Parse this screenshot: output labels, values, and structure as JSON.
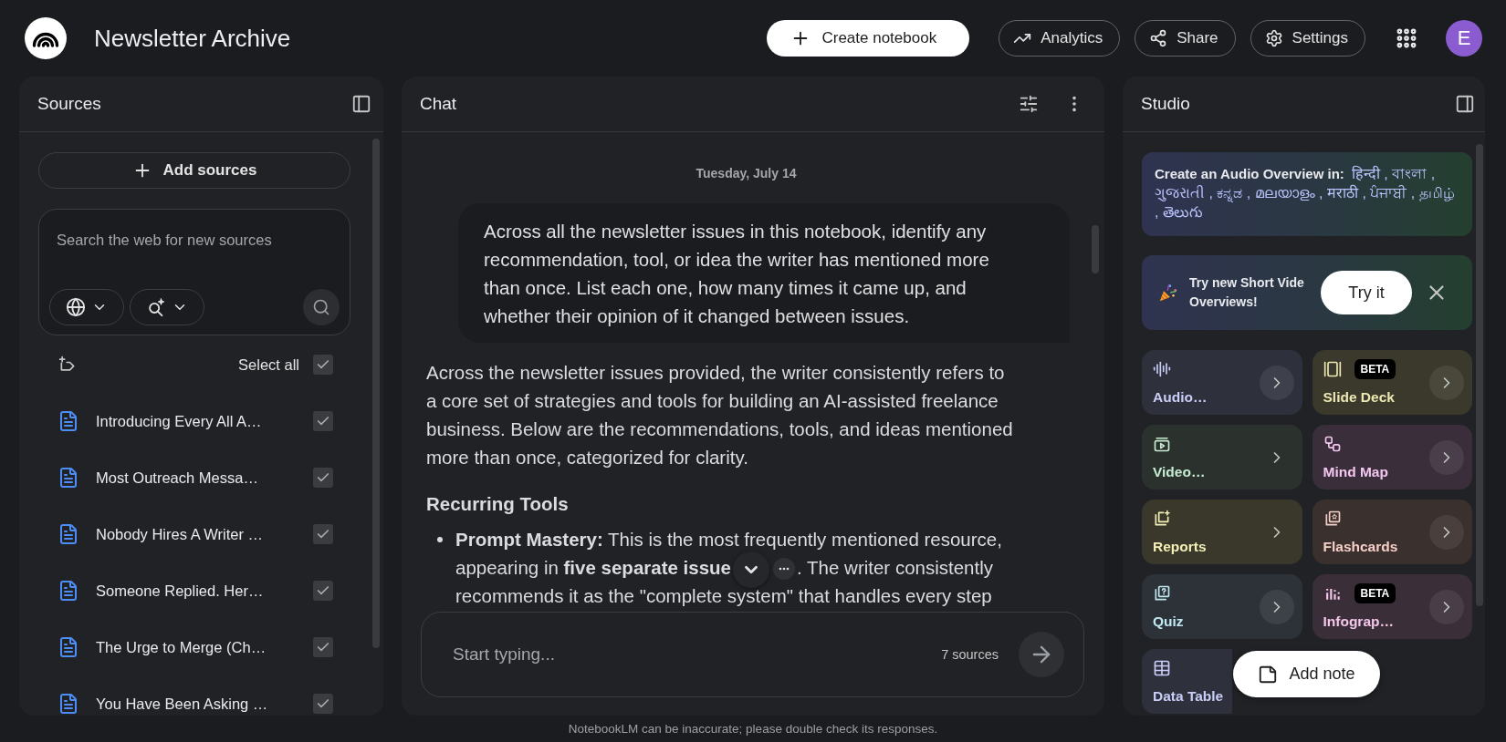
{
  "header": {
    "title": "Newsletter Archive",
    "create_button": "Create notebook",
    "actions": [
      {
        "kind": "analytics",
        "label": "Analytics"
      },
      {
        "kind": "share",
        "label": "Share"
      },
      {
        "kind": "settings",
        "label": "Settings"
      }
    ],
    "avatar": "E"
  },
  "sources": {
    "title": "Sources",
    "add_button": "Add sources",
    "search": {
      "placeholder": "Search the web for new sources"
    },
    "select_all": {
      "label": "Select all",
      "checked": true
    },
    "items": [
      {
        "title": "Introducing Every All A…",
        "checked": true
      },
      {
        "title": "Most Outreach Messa…",
        "checked": true
      },
      {
        "title": "Nobody Hires A Writer …",
        "checked": true
      },
      {
        "title": "Someone Replied. Her…",
        "checked": true
      },
      {
        "title": "The Urge to Merge (Ch…",
        "checked": true
      },
      {
        "title": "You Have Been Asking …",
        "checked": true
      }
    ]
  },
  "chat": {
    "title": "Chat",
    "date": "Tuesday, July 14",
    "user_message": "Across all the newsletter issues in this notebook, identify any recommendation, tool, or idea the writer has mentioned more than once. List each one, how many times it came up, and whether their opinion of it changed between issues.",
    "response": {
      "paragraph": "Across the newsletter issues provided, the writer consistently refers to a core set of strategies and tools for building an AI-assisted freelance business. Below are the recommendations, tools, and ideas mentioned more than once, categorized for clarity.",
      "heading": "Recurring Tools",
      "bullets": [
        {
          "text": "**Prompt Mastery:** This is the most frequently mentioned resource, appearing in **five separate issue**",
          "cited": true,
          "continuation": ". The writer consistently recommends it as the \"complete system\" that handles every step"
        }
      ]
    },
    "input": {
      "placeholder": "Start typing...",
      "source_count": "7 sources"
    }
  },
  "studio": {
    "title": "Studio",
    "audio_banner": {
      "text": "Create an Audio Overview in:",
      "languages": "हिन्दी , বাংলা , ગુજરાતી , ಕನ್ನಡ , മലയാളം , मराठी , ਪੰਜਾਬੀ , தமிழ் , తెలుగు"
    },
    "promo": {
      "text": "Try new Short Vide Overviews!",
      "button": "Try it"
    },
    "tools": [
      {
        "kind": "audio",
        "label": "Audio…"
      },
      {
        "kind": "video",
        "label": "Video…"
      },
      {
        "kind": "reports",
        "label": "Reports"
      },
      {
        "kind": "quiz",
        "label": "Quiz"
      },
      {
        "kind": "datatable",
        "label": "Data Table"
      },
      {
        "kind": "slides",
        "label": "Slide Deck",
        "badge": "BETA"
      },
      {
        "kind": "mindmap",
        "label": "Mind Map"
      },
      {
        "kind": "flashcards",
        "label": "Flashcards"
      },
      {
        "kind": "infographic",
        "label": "Infograp…",
        "badge": "BETA"
      }
    ],
    "add_note": "Add note"
  },
  "footer": "NotebookLM can be inaccurate; please double check its responses."
}
